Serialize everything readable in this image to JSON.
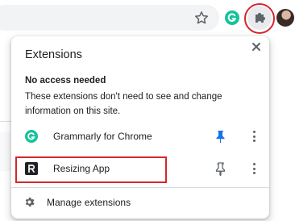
{
  "toolbar": {
    "icons": [
      "star-icon",
      "grammarly-icon",
      "puzzle-piece-icon",
      "avatar"
    ]
  },
  "popup": {
    "title": "Extensions",
    "close_symbol": "✕",
    "section": {
      "heading": "No access needed",
      "description": "These extensions don't need to see and change information on this site."
    },
    "extensions": [
      {
        "name": "Grammarly for Chrome",
        "icon_letter": "G",
        "pinned": true
      },
      {
        "name": "Resizing App",
        "icon_letter": "R",
        "pinned": false
      }
    ],
    "manage_label": "Manage extensions"
  },
  "colors": {
    "accent_blue": "#1a73e8",
    "highlight_red": "#d7262c",
    "grammarly_green": "#15c39a",
    "icon_gray": "#5f6368"
  }
}
